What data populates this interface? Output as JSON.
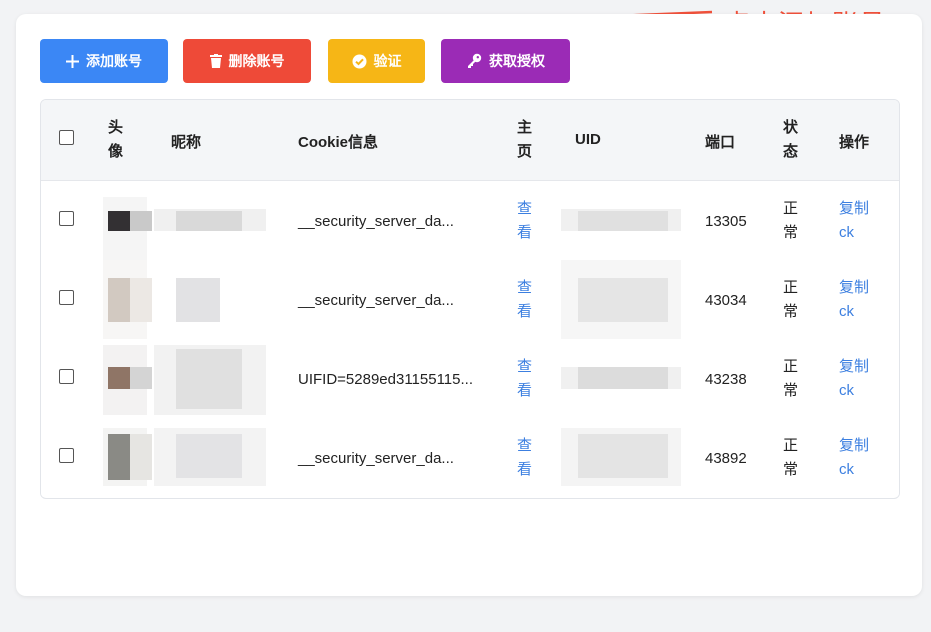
{
  "annotation": {
    "text": "点击添加账号",
    "color": "#f0513b"
  },
  "toolbar": {
    "add_label": "添加账号",
    "delete_label": "删除账号",
    "verify_label": "验证",
    "auth_label": "获取授权"
  },
  "table": {
    "headers": {
      "avatar_1": "头",
      "avatar_2": "像",
      "nickname": "昵称",
      "cookie": "Cookie信息",
      "home_1": "主",
      "home_2": "页",
      "uid": "UID",
      "port": "端口",
      "status_1": "状",
      "status_2": "态",
      "actions": "操作"
    },
    "rows": [
      {
        "cookie": "__security_server_da...",
        "view_1": "查",
        "view_2": "看",
        "port": "13305",
        "status_1": "正",
        "status_2": "常",
        "copy_1": "复制",
        "copy_2": "ck"
      },
      {
        "cookie": "__security_server_da...",
        "view_1": "查",
        "view_2": "看",
        "port": "43034",
        "status_1": "正",
        "status_2": "常",
        "copy_1": "复制",
        "copy_2": "ck"
      },
      {
        "cookie": "UIFID=5289ed31155115...",
        "view_1": "查",
        "view_2": "看",
        "port": "43238",
        "status_1": "正",
        "status_2": "常",
        "copy_1": "复制",
        "copy_2": "ck"
      },
      {
        "cookie": "__security_server_da...",
        "view_1": "查",
        "view_2": "看",
        "port": "43892",
        "status_1": "正",
        "status_2": "常",
        "copy_1": "复制",
        "copy_2": "ck"
      }
    ]
  },
  "colors": {
    "add_button": "#3b87f5",
    "delete_button": "#ee4a38",
    "verify_button": "#f6b616",
    "auth_button": "#9b2bb6",
    "link": "#3c7fe0"
  },
  "icons": {
    "add": "plus-icon",
    "delete": "trash-icon",
    "verify": "check-circle-icon",
    "auth": "key-icon"
  }
}
